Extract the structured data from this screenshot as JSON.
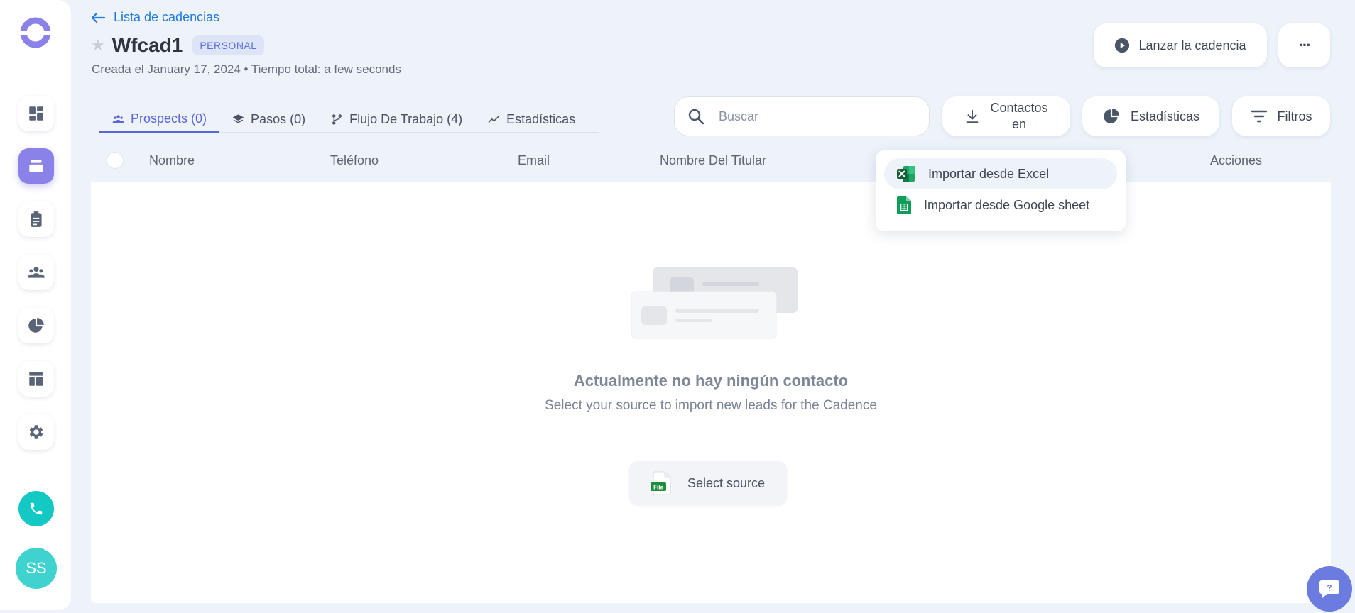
{
  "sidebar": {
    "nav_items": [
      {
        "icon": "dashboard-icon",
        "active": false
      },
      {
        "icon": "cadences-icon",
        "active": true
      },
      {
        "icon": "tasks-icon",
        "active": false
      },
      {
        "icon": "contacts-icon",
        "active": false
      },
      {
        "icon": "stats-icon",
        "active": false
      },
      {
        "icon": "templates-icon",
        "active": false
      },
      {
        "icon": "settings-icon",
        "active": false
      }
    ],
    "avatar_initials": "SS"
  },
  "header": {
    "back_label": "Lista de cadencias",
    "title": "Wfcad1",
    "badge": "PERSONAL",
    "subtitle": "Creada el January 17, 2024 • Tiempo total: a few seconds",
    "launch_label": "Lanzar la cadencia",
    "more_label": "···"
  },
  "tabs": [
    {
      "label": "Prospects (0)",
      "icon": "users-icon",
      "active": true
    },
    {
      "label": "Pasos (0)",
      "icon": "layers-icon",
      "active": false
    },
    {
      "label": "Flujo De Trabajo (4)",
      "icon": "branch-icon",
      "active": false
    },
    {
      "label": "Estadísticas",
      "icon": "trend-icon",
      "active": false
    }
  ],
  "toolbar": {
    "search_placeholder": "Buscar",
    "contactos_line1": "Contactos",
    "contactos_line2": "en",
    "stats_label": "Estadísticas",
    "filters_label": "Filtros"
  },
  "table": {
    "columns": [
      "Nombre",
      "Teléfono",
      "Email",
      "Nombre Del Titular",
      "Acciones"
    ]
  },
  "empty_state": {
    "title": "Actualmente no hay ningún contacto",
    "subtitle": "Select your source to import new leads for the Cadence",
    "button_label": "Select source",
    "file_icon_text": "File"
  },
  "dropdown": {
    "items": [
      {
        "label": "Importar desde Excel",
        "icon": "excel-icon"
      },
      {
        "label": "Importar desde Google sheet",
        "icon": "google-sheets-icon"
      }
    ]
  },
  "colors": {
    "accent": "#5a67d8",
    "sidebar_active": "#8a82e8",
    "phone": "#14c9c4",
    "link": "#1f7be0"
  }
}
